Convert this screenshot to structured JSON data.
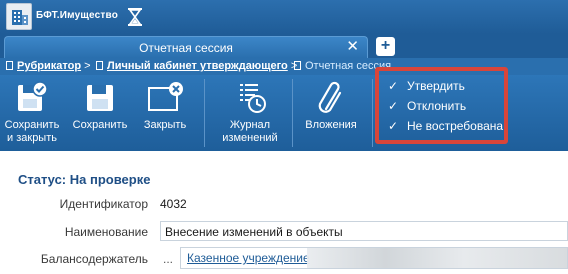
{
  "app": {
    "title": "БФТ.Имущество"
  },
  "tab": {
    "label": "Отчетная сессия",
    "close_symbol": "✕",
    "add_symbol": "+"
  },
  "breadcrumb": {
    "items": [
      {
        "label": "Рубрикатор",
        "separator": ">"
      },
      {
        "label": "Личный кабинет утверждающего",
        "separator": ">"
      },
      {
        "label": "Отчетная сессия",
        "separator": ""
      }
    ]
  },
  "toolbar": {
    "save_close": [
      "Сохранить",
      "и закрыть"
    ],
    "save": "Сохранить",
    "close": "Закрыть",
    "journal": [
      "Журнал",
      "изменений"
    ],
    "attachments": "Вложения"
  },
  "actions_menu": {
    "items": [
      {
        "label": "Утвердить",
        "icon": "check-icon"
      },
      {
        "label": "Отклонить",
        "icon": "check-icon"
      },
      {
        "label": "Не востребована",
        "icon": "check-icon"
      }
    ],
    "highlight_color": "#d8453a"
  },
  "form": {
    "status": "Статус: На проверке",
    "fields": [
      {
        "label": "Идентификатор",
        "value": "4032"
      },
      {
        "label": "Наименование",
        "value": "Внесение изменений в объекты"
      },
      {
        "label": "Балансодержатель",
        "prefix": "...",
        "value": "Казенное учреждение"
      }
    ]
  },
  "colors": {
    "toolbar_bg": "#2a6fae",
    "accent": "#1f5c97",
    "status_text": "#1f4f86"
  }
}
